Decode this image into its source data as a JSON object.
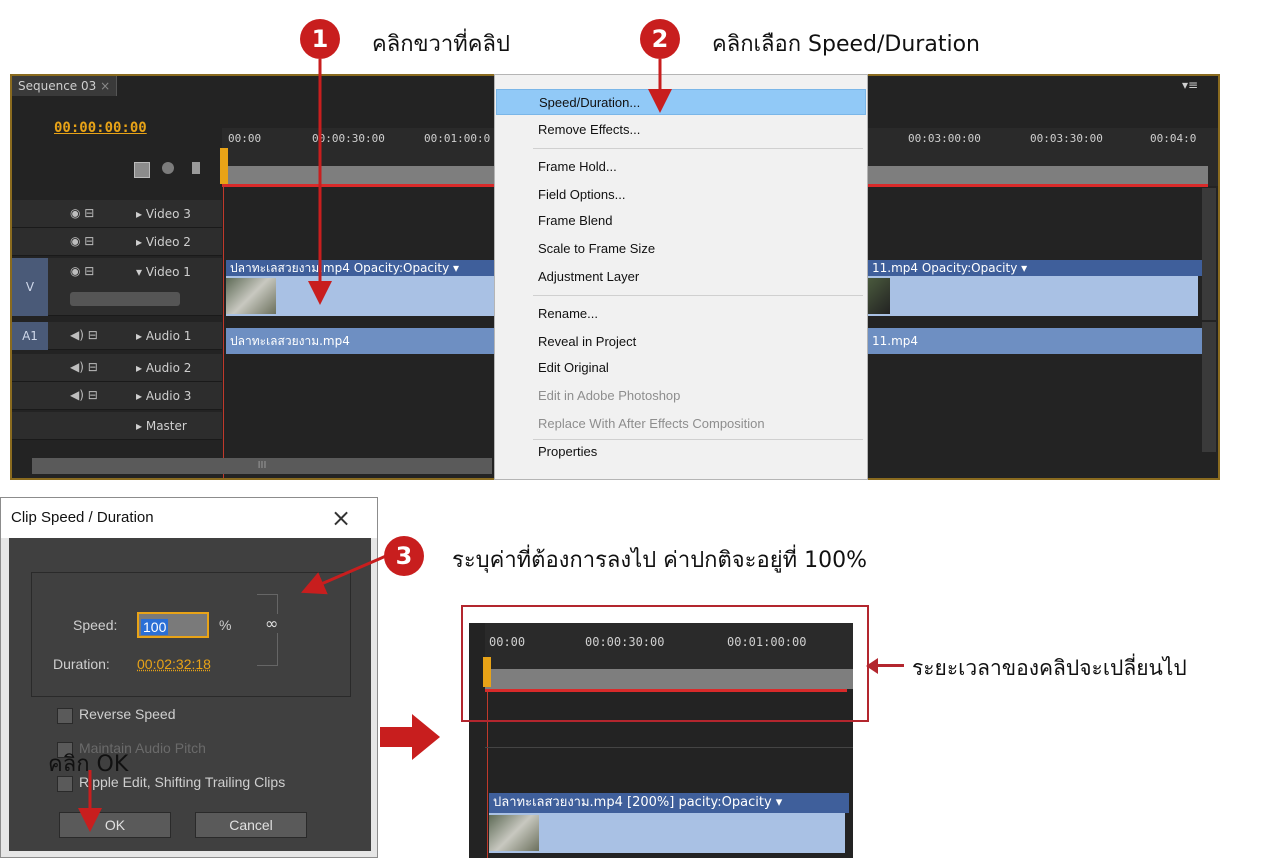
{
  "callouts": {
    "step1": {
      "num": "1",
      "text": "คลิกขวาที่คลิป"
    },
    "step2": {
      "num": "2",
      "text": "คลิกเลือก Speed/Duration"
    },
    "step3": {
      "num": "3",
      "text": "ระบุค่าที่ต้องการลงไป ค่าปกติจะอยู่ที่ 100%"
    },
    "click_ok": "คลิก OK",
    "duration_note": "ระยะเวลาของคลิปจะเปลี่ยนไป"
  },
  "timeline": {
    "tab_title": "Sequence 03",
    "timecode": "00:00:00:00",
    "ruler_left": [
      "00:00",
      "00:00:30:00",
      "00:01:00:0"
    ],
    "ruler_right": [
      "00:03:00:00",
      "00:03:30:00",
      "00:04:0"
    ],
    "tracks": [
      {
        "label": "Video 3",
        "tag": ""
      },
      {
        "label": "Video 2",
        "tag": ""
      },
      {
        "label": "Video 1",
        "tag": "V"
      },
      {
        "label": "Audio 1",
        "tag": "A1"
      },
      {
        "label": "Audio 2",
        "tag": ""
      },
      {
        "label": "Audio 3",
        "tag": ""
      },
      {
        "label": "Master",
        "tag": ""
      }
    ],
    "video_clip_left": "ปลาทะเลสวยงาม.mp4  Opacity:Opacity ▾",
    "video_clip_right": "11.mp4  Opacity:Opacity ▾",
    "audio_clip_left": "ปลาทะเลสวยงาม.mp4",
    "audio_clip_right": "11.mp4",
    "scroll_handle": "III"
  },
  "context_menu": {
    "items": [
      {
        "label": "Speed/Duration...",
        "state": "highlighted"
      },
      {
        "label": "Remove Effects...",
        "state": "normal"
      },
      {
        "label": "Frame Hold...",
        "state": "normal"
      },
      {
        "label": "Field Options...",
        "state": "normal"
      },
      {
        "label": "Frame Blend",
        "state": "normal"
      },
      {
        "label": "Scale to Frame Size",
        "state": "normal"
      },
      {
        "label": "Adjustment Layer",
        "state": "normal"
      },
      {
        "label": "Rename...",
        "state": "normal"
      },
      {
        "label": "Reveal in Project",
        "state": "normal"
      },
      {
        "label": "Edit Original",
        "state": "normal"
      },
      {
        "label": "Edit in Adobe Photoshop",
        "state": "disabled"
      },
      {
        "label": "Replace With After Effects Composition",
        "state": "disabled"
      },
      {
        "label": "Properties",
        "state": "normal"
      }
    ]
  },
  "dialog": {
    "title": "Clip Speed / Duration",
    "close": "×",
    "speed_label": "Speed:",
    "speed_value": "100",
    "speed_unit": "%",
    "duration_label": "Duration:",
    "duration_value": "00:02:32:18",
    "checkboxes": [
      "Reverse Speed",
      "Maintain Audio Pitch",
      "Ripple Edit, Shifting Trailing Clips"
    ],
    "ok": "OK",
    "cancel": "Cancel"
  },
  "result": {
    "ruler": [
      "00:00",
      "00:00:30:00",
      "00:01:00:00"
    ],
    "clip_label": "ปลาทะเลสวยงาม.mp4 [200%]",
    "clip_opacity": "pacity:Opacity ▾"
  },
  "colors": {
    "callout_red": "#c81e1e",
    "timecode": "#e8a317",
    "highlight": "#91c9f7",
    "clip_blue": "#3f5f9b"
  }
}
